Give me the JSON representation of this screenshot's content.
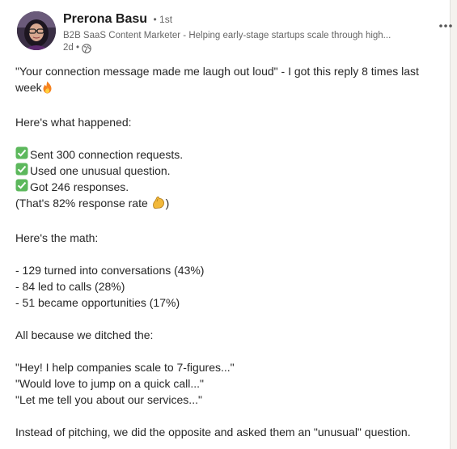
{
  "author": {
    "name": "Prerona Basu",
    "degree": "• 1st",
    "headline": "B2B SaaS Content Marketer - Helping early-stage startups scale through high...",
    "time": "2d •"
  },
  "post": {
    "line1": "\"Your connection message made me laugh out loud\" - I got this reply 8 times last",
    "line2": "week",
    "line3": "Here's what happened:",
    "checks": [
      "Sent 300 connection requests.",
      "Used one unusual question.",
      "Got 246 responses."
    ],
    "rate": "(That's 82% response rate",
    "rate_end": ")",
    "math_title": "Here's the math:",
    "math": [
      "- 129 turned into conversations (43%)",
      "- 84 led to calls (28%)",
      "- 51 became opportunities (17%)"
    ],
    "ditched": "All because we ditched the:",
    "quotes": [
      "\"Hey! I help companies scale to 7-figures...\"",
      "\"Would love to jump on a quick call...\"",
      "\"Let me tell you about our services...\""
    ],
    "closing": "Instead of pitching, we did the opposite and asked them an \"unusual\" question."
  },
  "icons": {
    "more": "more-options-icon",
    "visibility": "globe-icon",
    "fire": "fire-emoji",
    "check": "check-mark-emoji",
    "flex": "flexed-biceps-emoji"
  },
  "colors": {
    "check_green": "#5cb85c",
    "text": "#262626",
    "muted": "#666666"
  }
}
